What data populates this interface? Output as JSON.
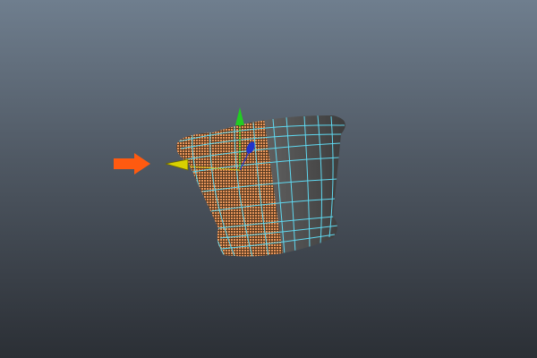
{
  "viewport": {
    "background_top": "#6f7e8e",
    "background_bottom": "#2b2f35"
  },
  "model": {
    "name_icon": "pot-mesh",
    "selected_faces_color": "#e8955a",
    "unselected_faces_color": "#6a6a6a",
    "wireframe_color": "#5fd8f0"
  },
  "manipulator": {
    "y_axis_color": "#22cc22",
    "x_axis_color": "#d8d000",
    "z_axis_color": "#2233cc"
  },
  "annotation": {
    "arrow_color": "#ff5a10"
  }
}
